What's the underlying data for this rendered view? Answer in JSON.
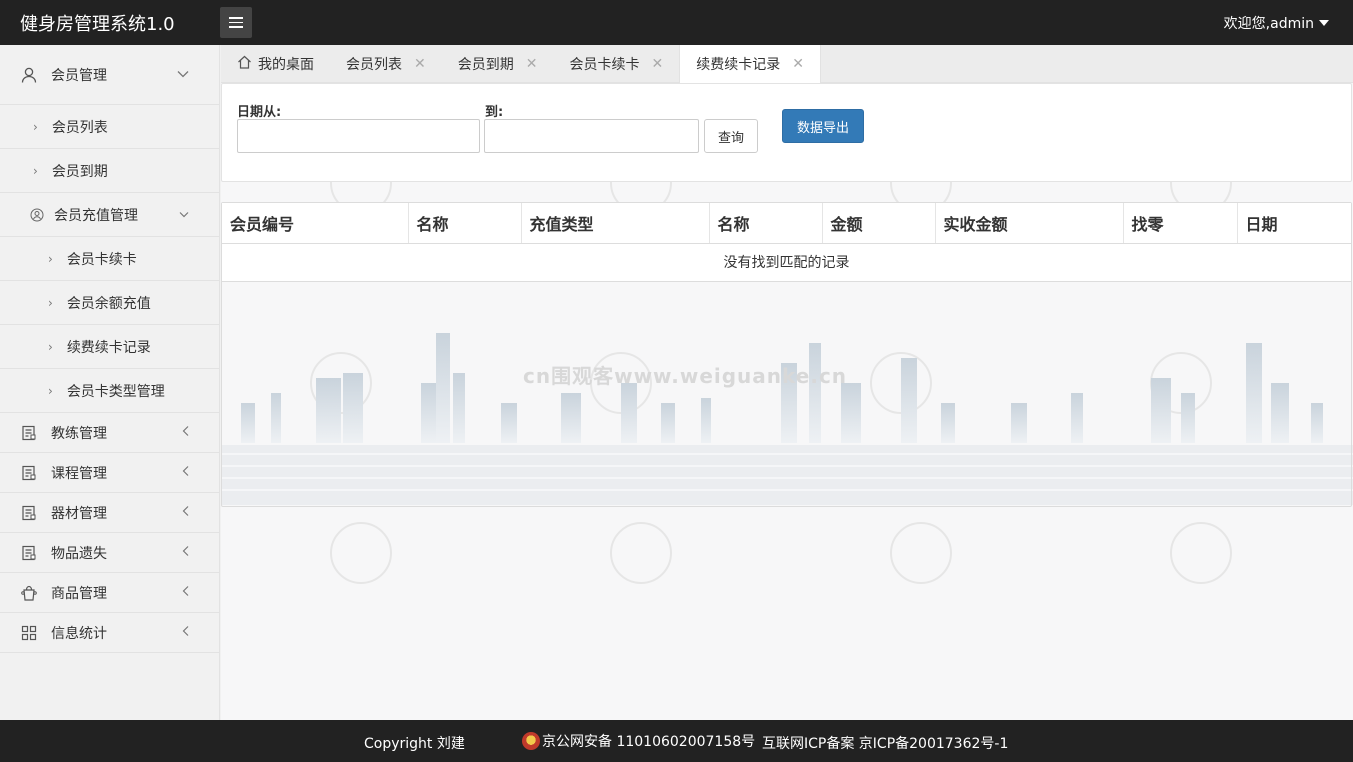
{
  "header": {
    "app_title": "健身房管理系统1.0",
    "user_greeting": "欢迎您,admin"
  },
  "sidebar": {
    "items": [
      {
        "label": "会员管理",
        "icon": "user-icon",
        "level": 1,
        "expanded": true
      },
      {
        "label": "会员列表",
        "level": 2
      },
      {
        "label": "会员到期",
        "level": 2
      },
      {
        "label": "会员充值管理",
        "icon": "user-circle-icon",
        "level": 2,
        "expanded": true
      },
      {
        "label": "会员卡续卡",
        "level": 3
      },
      {
        "label": "会员余额充值",
        "level": 3
      },
      {
        "label": "续费续卡记录",
        "level": 3
      },
      {
        "label": "会员卡类型管理",
        "level": 3
      },
      {
        "label": "教练管理",
        "icon": "document-icon",
        "level": 1
      },
      {
        "label": "课程管理",
        "icon": "document-icon",
        "level": 1
      },
      {
        "label": "器材管理",
        "icon": "document-icon",
        "level": 1
      },
      {
        "label": "物品遗失",
        "icon": "document-icon",
        "level": 1
      },
      {
        "label": "商品管理",
        "icon": "bag-icon",
        "level": 1
      },
      {
        "label": "信息统计",
        "icon": "grid-icon",
        "level": 1
      }
    ]
  },
  "tabs": [
    {
      "label": "我的桌面",
      "icon": "home-icon",
      "closable": false
    },
    {
      "label": "会员列表",
      "closable": true
    },
    {
      "label": "会员到期",
      "closable": true
    },
    {
      "label": "会员卡续卡",
      "closable": true
    },
    {
      "label": "续费续卡记录",
      "closable": true,
      "active": true
    }
  ],
  "filter": {
    "date_from_label": "日期从:",
    "date_to_label": "到:",
    "date_from_value": "",
    "date_to_value": "",
    "query_button": "查询",
    "export_button": "数据导出"
  },
  "table": {
    "columns": [
      "会员编号",
      "名称",
      "充值类型",
      "名称",
      "金额",
      "实收金额",
      "找零",
      "日期"
    ],
    "empty_message": "没有找到匹配的记录"
  },
  "watermark": {
    "text": "cn围观客www.weiguanke.cn"
  },
  "footer": {
    "copyright": "Copyright 刘建",
    "police_record": "京公网安备 11010602007158号",
    "icp_record": "互联网ICP备案 京ICP备20017362号-1"
  },
  "colors": {
    "header_bg": "#222222",
    "primary_button": "#337ab7",
    "sidebar_bg": "#f1f1f1"
  }
}
